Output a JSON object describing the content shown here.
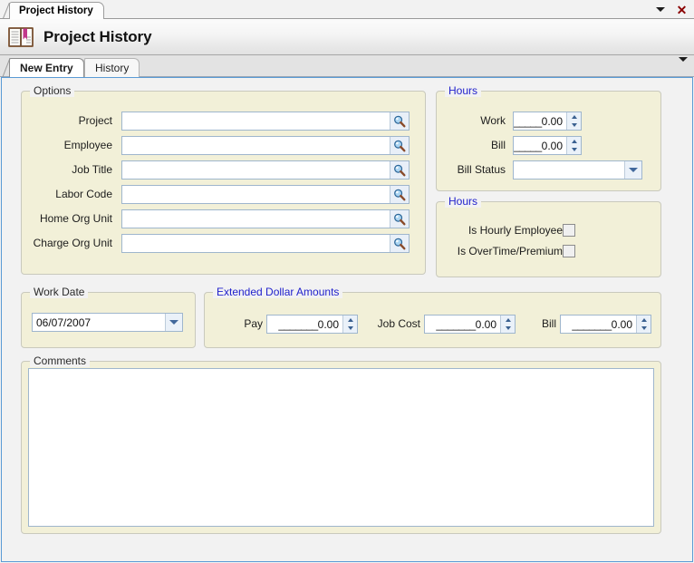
{
  "window": {
    "tab_title": "Project History",
    "header_title": "Project History",
    "icon": "open-book-icon",
    "menu_icon": "chevron-down-icon",
    "close_icon": "close-x-icon",
    "close_label": "✕"
  },
  "tabs": {
    "items": [
      {
        "label": "New Entry",
        "active": true
      },
      {
        "label": "History",
        "active": false
      }
    ],
    "overflow_icon": "chevron-down-icon"
  },
  "options": {
    "legend": "Options",
    "fields": [
      {
        "label": "Project",
        "value": "",
        "placeholder": "",
        "lookup_icon": "search-icon"
      },
      {
        "label": "Employee",
        "value": "",
        "placeholder": "",
        "lookup_icon": "search-icon"
      },
      {
        "label": "Job Title",
        "value": "",
        "placeholder": "",
        "lookup_icon": "search-icon"
      },
      {
        "label": "Labor Code",
        "value": "",
        "placeholder": "",
        "lookup_icon": "search-icon"
      },
      {
        "label": "Home Org Unit",
        "value": "",
        "placeholder": "",
        "lookup_icon": "search-icon"
      },
      {
        "label": "Charge Org Unit",
        "value": "",
        "placeholder": "",
        "lookup_icon": "search-icon"
      }
    ]
  },
  "hours_top": {
    "legend": "Hours",
    "work_label": "Work",
    "work_value": "0.00",
    "work_prefix": "_____",
    "bill_label": "Bill",
    "bill_value": "0.00",
    "bill_prefix": "_____",
    "bill_status_label": "Bill Status",
    "bill_status_value": "",
    "bill_status_options": []
  },
  "hours_bottom": {
    "legend": "Hours",
    "checkboxes": [
      {
        "label": "Is Hourly Employee",
        "checked": false
      },
      {
        "label": "Is OverTime/Premium",
        "checked": false
      }
    ]
  },
  "work_date": {
    "legend": "Work Date",
    "value": "06/07/2007"
  },
  "extended": {
    "legend": "Extended Dollar Amounts",
    "fields": [
      {
        "label": "Pay",
        "value": "0.00",
        "prefix": "_______"
      },
      {
        "label": "Job Cost",
        "value": "0.00",
        "prefix": "_______"
      },
      {
        "label": "Bill",
        "value": "0.00",
        "prefix": "_______"
      }
    ]
  },
  "comments": {
    "legend": "Comments",
    "value": "",
    "placeholder": ""
  },
  "colors": {
    "group_bg": "#f2f0d8",
    "panel_border": "#5a9bd5",
    "legend_blue": "#2222cc",
    "field_border": "#9fb6cd",
    "close_red": "#8b0000"
  }
}
